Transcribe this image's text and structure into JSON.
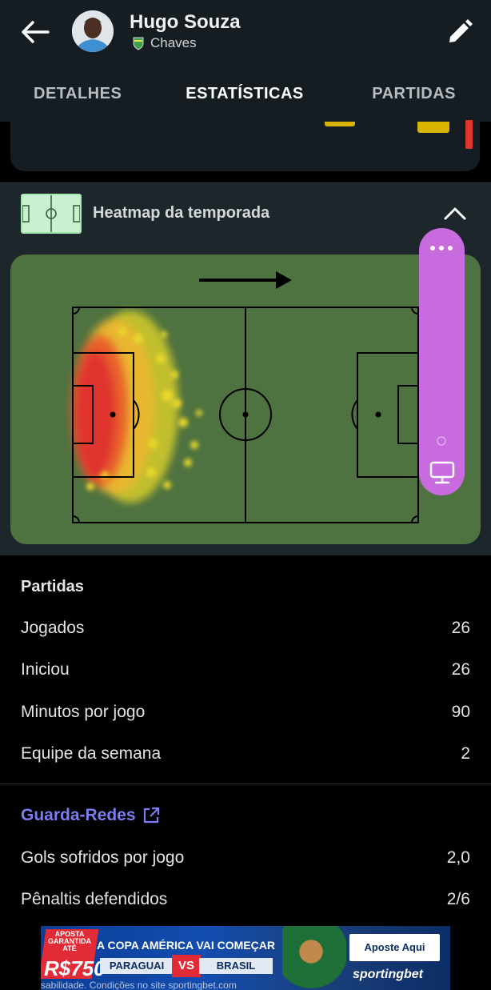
{
  "header": {
    "player_name": "Hugo Souza",
    "team_name": "Chaves",
    "back_icon": "arrow-left-icon",
    "edit_icon": "pencil-icon"
  },
  "tabs": [
    {
      "label": "DETALHES",
      "active": false
    },
    {
      "label": "ESTATÍSTICAS",
      "active": true
    },
    {
      "label": "PARTIDAS",
      "active": false
    }
  ],
  "heatmap": {
    "title": "Heatmap da temporada",
    "attack_direction": "right",
    "pitch_color": "#4e7240"
  },
  "stats": {
    "matches": {
      "title": "Partidas",
      "rows": [
        {
          "label": "Jogados",
          "value": "26"
        },
        {
          "label": "Iniciou",
          "value": "26"
        },
        {
          "label": "Minutos por jogo",
          "value": "90"
        },
        {
          "label": "Equipe da semana",
          "value": "2"
        }
      ]
    },
    "goalkeeper": {
      "title": "Guarda-Redes",
      "rows": [
        {
          "label": "Gols sofridos por jogo",
          "value": "2,0"
        },
        {
          "label": "Pênaltis defendidos",
          "value": "2/6"
        }
      ]
    }
  },
  "ad": {
    "badge_text": "APOSTA GARANTIDA ATÉ",
    "amount": "R$750",
    "headline": "A COPA AMÉRICA VAI COMEÇAR",
    "team1": "PARAGUAI",
    "vs": "VS",
    "team2": "BRASIL",
    "cta": "Aposte Aqui",
    "brand": "sportingbet",
    "disclaimer": "sabilidade. Condições no site sportingbet.com"
  },
  "colors": {
    "accent_link": "#7a7cf0",
    "widget": "#c86bde",
    "heat_red": "#e0342f",
    "heat_yellow": "#e8d82a"
  }
}
